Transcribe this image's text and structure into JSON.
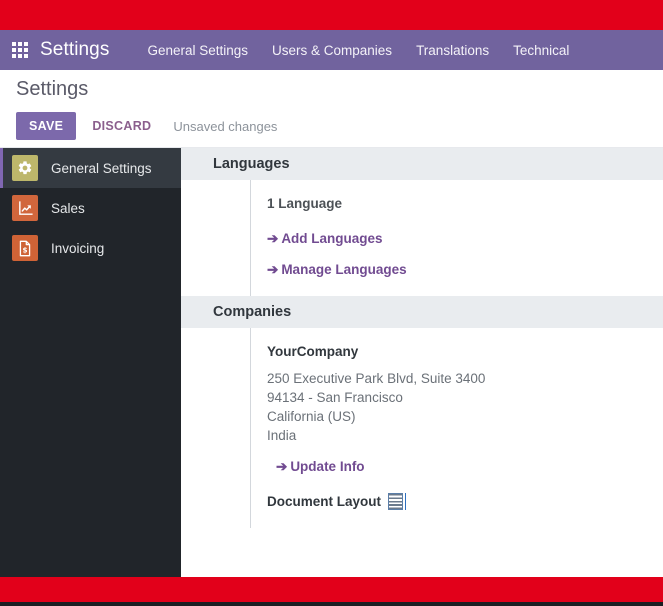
{
  "navbar": {
    "apps_icon": "apps-grid-icon",
    "brand": "Settings",
    "items": [
      {
        "label": "General Settings"
      },
      {
        "label": "Users & Companies"
      },
      {
        "label": "Translations"
      },
      {
        "label": "Technical"
      }
    ],
    "bg_color": "#71639e"
  },
  "control_panel": {
    "title": "Settings",
    "save_label": "SAVE",
    "discard_label": "DISCARD",
    "status_text": "Unsaved changes",
    "save_bg_color": "#7c69ab",
    "discard_color": "#8b5f8d"
  },
  "sidebar": {
    "items": [
      {
        "label": "General Settings",
        "icon": "gear-icon",
        "icon_color": "#bdb76b",
        "active": true
      },
      {
        "label": "Sales",
        "icon": "chart-line-icon",
        "icon_color": "#d1663c",
        "active": false
      },
      {
        "label": "Invoicing",
        "icon": "invoice-document-icon",
        "icon_color": "#cf6336",
        "active": false
      }
    ],
    "bg_color": "#21252a",
    "active_accent_color": "#8067b3"
  },
  "settings": {
    "languages": {
      "header": "Languages",
      "count_label": "1 Language",
      "add_link": "Add Languages",
      "manage_link": "Manage Languages"
    },
    "companies": {
      "header": "Companies",
      "company_name": "YourCompany",
      "address": [
        "250 Executive Park Blvd, Suite 3400",
        "94134 - San Francisco",
        "California (US)",
        "India"
      ],
      "update_link": "Update Info",
      "document_layout_label": "Document Layout",
      "document_layout_icon": "building-icon"
    },
    "arrow_glyph": "➔",
    "link_color": "#714b91",
    "header_bg_color": "#e9ecef"
  },
  "recording_bands": {
    "top_color": "#e2001a",
    "bottom_color": "#e2001a"
  }
}
